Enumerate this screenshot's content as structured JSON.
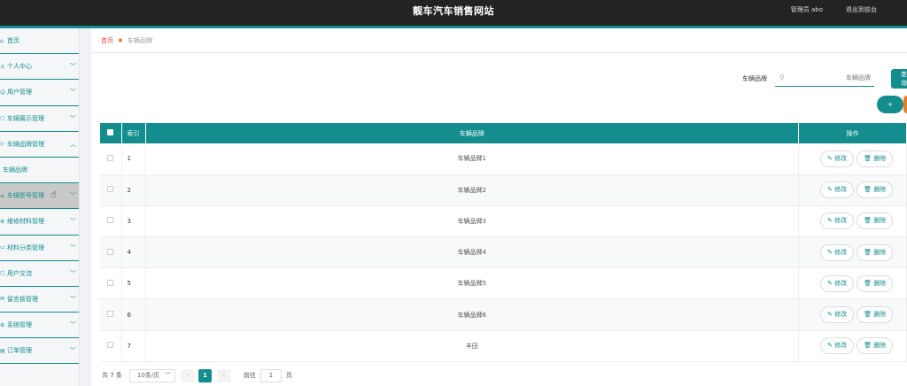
{
  "header": {
    "title": "靓车汽车销售网站",
    "user": "管理员 abo",
    "logout": "退出到前台"
  },
  "sidebar": {
    "items": [
      {
        "label": "首页",
        "icon": "home-icon"
      },
      {
        "label": "个人中心",
        "icon": "user-icon"
      },
      {
        "label": "用户管理",
        "icon": "users-icon"
      },
      {
        "label": "车辆展示管理",
        "icon": "car-icon"
      },
      {
        "label": "车辆品牌管理",
        "icon": "tag-icon"
      },
      {
        "label": "车辆品牌",
        "icon": ""
      },
      {
        "label": "车辆型号管理",
        "icon": "list-icon"
      },
      {
        "label": "维修材料管理",
        "icon": "tool-icon"
      },
      {
        "label": "材料分类管理",
        "icon": "folder-icon"
      },
      {
        "label": "用户交流",
        "icon": "chat-icon"
      },
      {
        "label": "留言板管理",
        "icon": "message-icon"
      },
      {
        "label": "系统管理",
        "icon": "gear-icon"
      },
      {
        "label": "订单管理",
        "icon": "order-icon"
      }
    ]
  },
  "breadcrumb": {
    "home": "首页",
    "current": "车辆品牌"
  },
  "search": {
    "label": "车辆品牌",
    "placeholder": "车辆品牌",
    "button": "查询"
  },
  "toolbar": {
    "add_label": "+"
  },
  "table": {
    "headers": {
      "index": "索引",
      "brand": "车辆品牌",
      "ops": "操作"
    },
    "edit_label": "修改",
    "delete_label": "删除",
    "rows": [
      {
        "index": "1",
        "brand": "车辆品牌1"
      },
      {
        "index": "2",
        "brand": "车辆品牌2"
      },
      {
        "index": "3",
        "brand": "车辆品牌3"
      },
      {
        "index": "4",
        "brand": "车辆品牌4"
      },
      {
        "index": "5",
        "brand": "车辆品牌5"
      },
      {
        "index": "6",
        "brand": "车辆品牌6"
      },
      {
        "index": "7",
        "brand": "丰田"
      }
    ]
  },
  "pagination": {
    "total": "共 7 条",
    "page_size": "10条/页",
    "current_page": "1",
    "goto_label": "前往",
    "goto_value": "1",
    "page_unit": "页"
  },
  "colors": {
    "accent": "#138d8d",
    "header_bg": "#232323"
  }
}
